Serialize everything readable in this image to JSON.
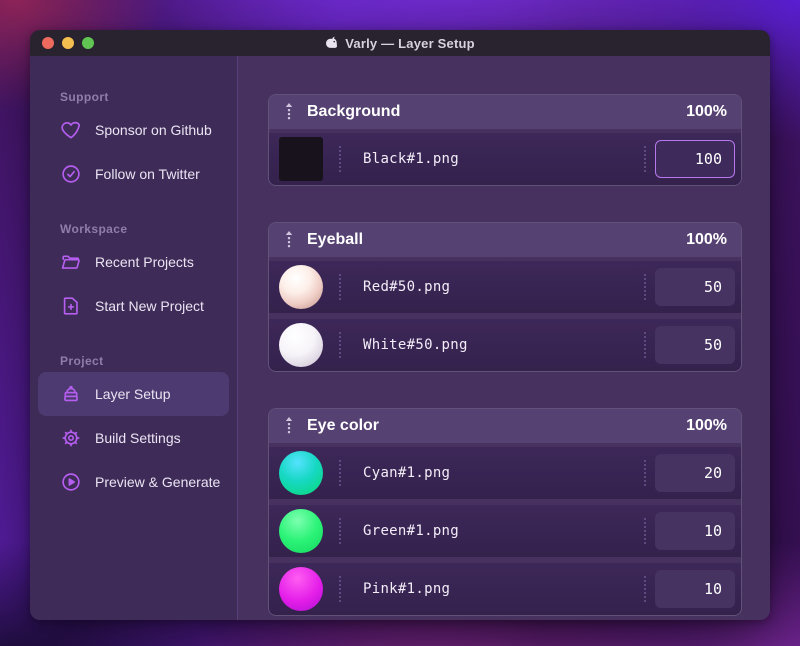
{
  "window": {
    "title": "Varly — Layer Setup",
    "traffic_lights": [
      {
        "name": "close-button",
        "color": "#ee6a5f"
      },
      {
        "name": "minimize-button",
        "color": "#f5bf4f"
      },
      {
        "name": "zoom-button",
        "color": "#61c554"
      }
    ]
  },
  "sidebar": {
    "sections": [
      {
        "label": "Support",
        "items": [
          {
            "icon": "heart-icon",
            "label": "Sponsor on Github",
            "active": false
          },
          {
            "icon": "check-badge-icon",
            "label": "Follow on Twitter",
            "active": false
          }
        ]
      },
      {
        "label": "Workspace",
        "items": [
          {
            "icon": "folder-icon",
            "label": "Recent Projects",
            "active": false
          },
          {
            "icon": "file-plus-icon",
            "label": "Start New Project",
            "active": false
          }
        ]
      },
      {
        "label": "Project",
        "items": [
          {
            "icon": "layers-icon",
            "label": "Layer Setup",
            "active": true
          },
          {
            "icon": "gear-icon",
            "label": "Build Settings",
            "active": false
          },
          {
            "icon": "play-circle-icon",
            "label": "Preview & Generate",
            "active": false
          }
        ]
      }
    ]
  },
  "main": {
    "groups": [
      {
        "name": "Background",
        "opacity": "100%",
        "layers": [
          {
            "file": "Black#1.png",
            "weight": "100",
            "thumb": "black-square",
            "focused": true
          }
        ]
      },
      {
        "name": "Eyeball",
        "opacity": "100%",
        "layers": [
          {
            "file": "Red#50.png",
            "weight": "50",
            "thumb": "pearl-red",
            "focused": false
          },
          {
            "file": "White#50.png",
            "weight": "50",
            "thumb": "pearl-white",
            "focused": false
          }
        ]
      },
      {
        "name": "Eye color",
        "opacity": "100%",
        "layers": [
          {
            "file": "Cyan#1.png",
            "weight": "20",
            "thumb": "ball-cyan",
            "focused": false
          },
          {
            "file": "Green#1.png",
            "weight": "10",
            "thumb": "ball-green",
            "focused": false
          },
          {
            "file": "Pink#1.png",
            "weight": "10",
            "thumb": "ball-pink",
            "focused": false
          }
        ]
      }
    ]
  },
  "colors": {
    "accent_icon": "#b55ef0",
    "focus_border": "#b678ec",
    "titlebar_bg": "#29222f",
    "sidebar_bg": "#3e2b57",
    "main_bg": "#46315f",
    "group_header_bg": "#564272",
    "row_bg": "#3a2553"
  }
}
